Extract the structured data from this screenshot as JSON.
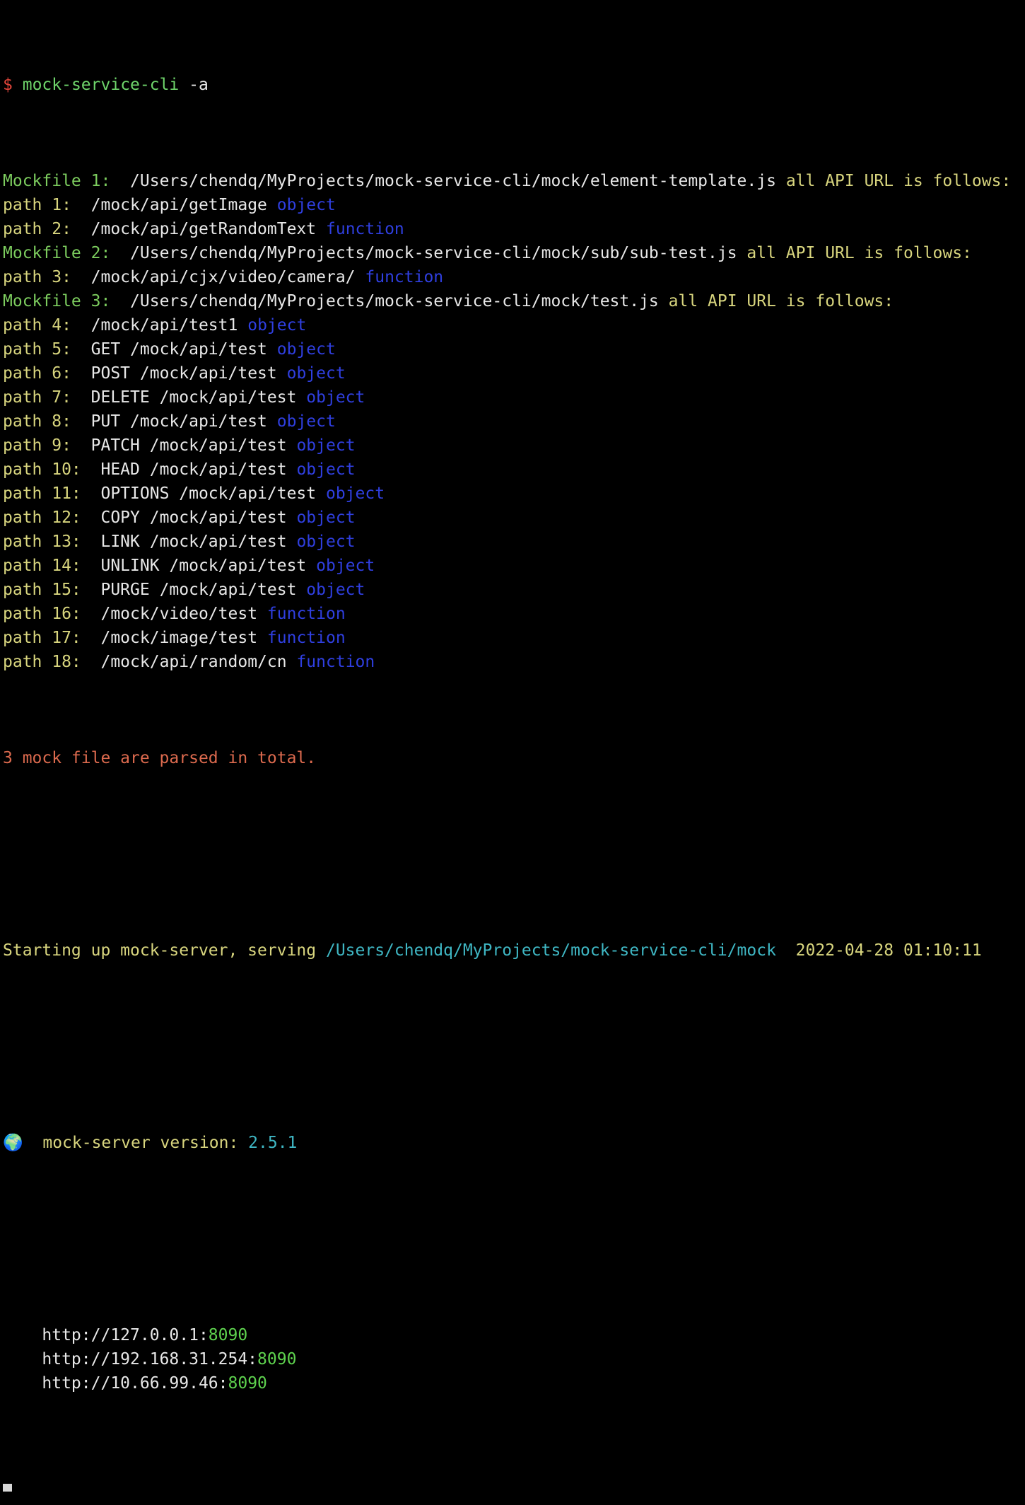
{
  "prompt": {
    "symbol": "$",
    "command": "mock-service-cli",
    "args": " -a"
  },
  "mockfiles": [
    {
      "label": "Mockfile 1:",
      "path": "/Users/chendq/MyProjects/mock-service-cli/mock/element-template.js",
      "suffix": "all API URL is follows:",
      "paths": [
        {
          "label": "path 1:",
          "pad": "  ",
          "url": "/mock/api/getImage",
          "type": "object"
        },
        {
          "label": "path 2:",
          "pad": "  ",
          "url": "/mock/api/getRandomText",
          "type": "function"
        }
      ]
    },
    {
      "label": "Mockfile 2:",
      "path": "/Users/chendq/MyProjects/mock-service-cli/mock/sub/sub-test.js",
      "suffix": "all API URL is follows:",
      "paths": [
        {
          "label": "path 3:",
          "pad": "  ",
          "url": "/mock/api/cjx/video/camera/",
          "type": "function"
        }
      ]
    },
    {
      "label": "Mockfile 3:",
      "path": "/Users/chendq/MyProjects/mock-service-cli/mock/test.js",
      "suffix": "all API URL is follows:",
      "paths": [
        {
          "label": "path 4:",
          "pad": "  ",
          "url": "/mock/api/test1",
          "type": "object"
        },
        {
          "label": "path 5:",
          "pad": "  ",
          "url": "GET /mock/api/test",
          "type": "object"
        },
        {
          "label": "path 6:",
          "pad": "  ",
          "url": "POST /mock/api/test",
          "type": "object"
        },
        {
          "label": "path 7:",
          "pad": "  ",
          "url": "DELETE /mock/api/test",
          "type": "object"
        },
        {
          "label": "path 8:",
          "pad": "  ",
          "url": "PUT /mock/api/test",
          "type": "object"
        },
        {
          "label": "path 9:",
          "pad": "  ",
          "url": "PATCH /mock/api/test",
          "type": "object"
        },
        {
          "label": "path 10:",
          "pad": "  ",
          "url": "HEAD /mock/api/test",
          "type": "object"
        },
        {
          "label": "path 11:",
          "pad": "  ",
          "url": "OPTIONS /mock/api/test",
          "type": "object"
        },
        {
          "label": "path 12:",
          "pad": "  ",
          "url": "COPY /mock/api/test",
          "type": "object"
        },
        {
          "label": "path 13:",
          "pad": "  ",
          "url": "LINK /mock/api/test",
          "type": "object"
        },
        {
          "label": "path 14:",
          "pad": "  ",
          "url": "UNLINK /mock/api/test",
          "type": "object"
        },
        {
          "label": "path 15:",
          "pad": "  ",
          "url": "PURGE /mock/api/test",
          "type": "object"
        },
        {
          "label": "path 16:",
          "pad": "  ",
          "url": "/mock/video/test",
          "type": "function"
        },
        {
          "label": "path 17:",
          "pad": "  ",
          "url": "/mock/image/test",
          "type": "function"
        },
        {
          "label": "path 18:",
          "pad": "  ",
          "url": "/mock/api/random/cn",
          "type": "function"
        }
      ]
    }
  ],
  "summary": "3 mock file are parsed in total.",
  "startup": {
    "prefix": "Starting up mock-server, serving",
    "path": "/Users/chendq/MyProjects/mock-service-cli/mock",
    "timestamp": "2022-04-28 01:10:11"
  },
  "version": {
    "icon": "globe-icon",
    "glyph": "🌍",
    "label": "mock-server version:",
    "value": "2.5.1"
  },
  "urls": [
    {
      "host": "http://127.0.0.1:",
      "port": "8090"
    },
    {
      "host": "http://192.168.31.254:",
      "port": "8090"
    },
    {
      "host": "http://10.66.99.46:",
      "port": "8090"
    }
  ],
  "colors": {
    "background": "#000000",
    "prompt": "#e0453a",
    "command": "#6fd56b",
    "mockfile_label": "#7ccc5e",
    "path_label": "#d8d57e",
    "type": "#2f3fe0",
    "summary": "#dc6a4e",
    "serving_path": "#3fb7c4",
    "port": "#5ed24e"
  }
}
